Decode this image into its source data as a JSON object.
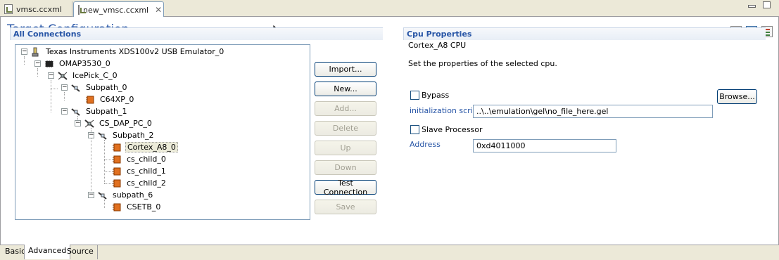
{
  "editor_tabs": [
    {
      "label": "vmsc.ccxml",
      "icon": "ccxml-file-icon",
      "active": false
    },
    {
      "label": "new_vmsc.ccxml",
      "icon": "ccxml-file-icon",
      "active": true,
      "close_glyph": "✕"
    }
  ],
  "page": {
    "title": "Target Configuration"
  },
  "connections": {
    "header": "All Connections",
    "tree": [
      {
        "label": "Texas Instruments XDS100v2 USB Emulator_0",
        "icon": "emulator-icon",
        "expanded": true,
        "level": 0
      },
      {
        "label": "OMAP3530_0",
        "icon": "chip-icon",
        "expanded": true,
        "level": 1
      },
      {
        "label": "IcePick_C_0",
        "icon": "router-icon",
        "expanded": true,
        "level": 2
      },
      {
        "label": "Subpath_0",
        "icon": "subpath-icon",
        "expanded": true,
        "level": 3
      },
      {
        "label": "C64XP_0",
        "icon": "cpu-icon",
        "expanded": null,
        "level": 4
      },
      {
        "label": "Subpath_1",
        "icon": "subpath-icon",
        "expanded": true,
        "level": 3
      },
      {
        "label": "CS_DAP_PC_0",
        "icon": "router-icon",
        "expanded": true,
        "level": 4
      },
      {
        "label": "Subpath_2",
        "icon": "subpath-icon",
        "expanded": true,
        "level": 5
      },
      {
        "label": "Cortex_A8_0",
        "icon": "cpu-icon",
        "expanded": null,
        "level": 6,
        "selected": true
      },
      {
        "label": "cs_child_0",
        "icon": "cpu-icon",
        "expanded": null,
        "level": 6
      },
      {
        "label": "cs_child_1",
        "icon": "cpu-icon",
        "expanded": null,
        "level": 6
      },
      {
        "label": "cs_child_2",
        "icon": "cpu-icon",
        "expanded": null,
        "level": 6
      },
      {
        "label": "subpath_6",
        "icon": "subpath-icon",
        "expanded": true,
        "level": 5
      },
      {
        "label": "CSETB_0",
        "icon": "cpu-icon",
        "expanded": null,
        "level": 6
      }
    ],
    "buttons": {
      "import": {
        "label": "Import...",
        "enabled": true
      },
      "new": {
        "label": "New...",
        "enabled": true
      },
      "add": {
        "label": "Add...",
        "enabled": false
      },
      "delete": {
        "label": "Delete",
        "enabled": false
      },
      "up": {
        "label": "Up",
        "enabled": false
      },
      "down": {
        "label": "Down",
        "enabled": false
      },
      "test_connection": {
        "label": "Test Connection",
        "enabled": true
      },
      "save": {
        "label": "Save",
        "enabled": false
      }
    }
  },
  "cpu_properties": {
    "header": "Cpu Properties",
    "cpu_name": "Cortex_A8 CPU",
    "description": "Set the properties of the selected cpu.",
    "bypass_label": "Bypass",
    "bypass_checked": false,
    "init_script_label": "initialization script",
    "init_script_value": "..\\..\\emulation\\gel\\no_file_here.gel",
    "browse_label": "Browse...",
    "slave_processor_label": "Slave Processor",
    "slave_processor_checked": false,
    "address_label": "Address",
    "address_value": "0xd4011000"
  },
  "bottom_tabs": [
    {
      "label": "Basic",
      "active": false
    },
    {
      "label": "Advanced",
      "active": true
    },
    {
      "label": "Source",
      "active": false
    }
  ],
  "colors": {
    "title_blue": "#2755a6",
    "icon_orange": "#e07020",
    "button_border": "#003c74",
    "selected_item_bg": "#ecebd9"
  }
}
